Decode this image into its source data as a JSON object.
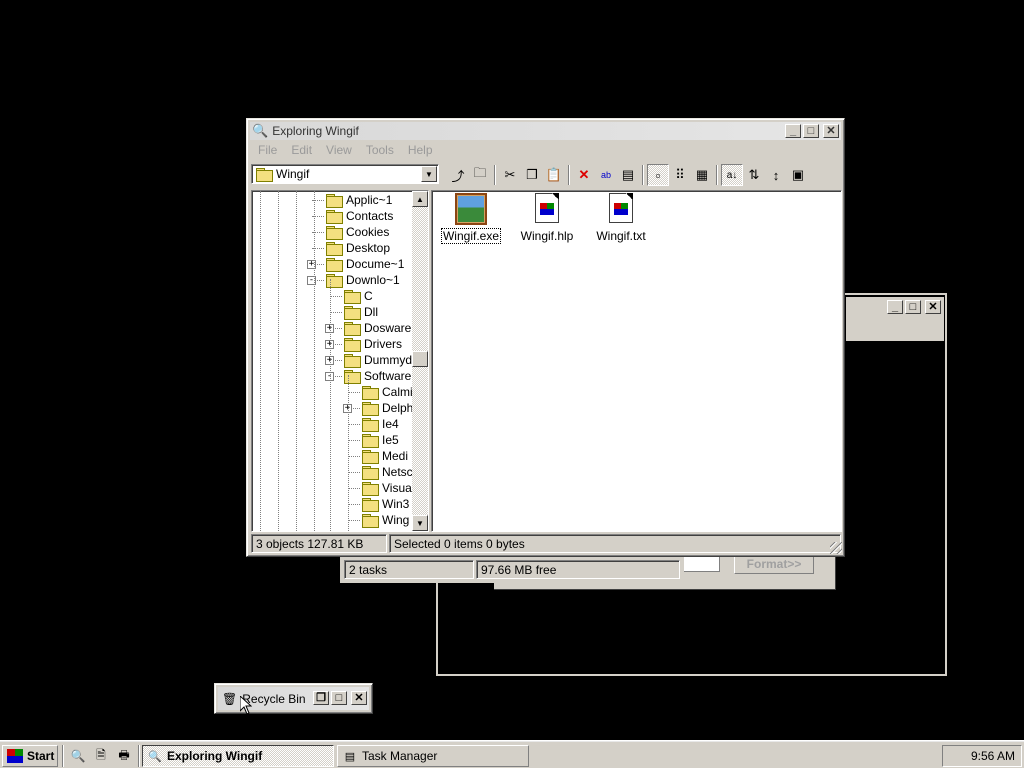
{
  "explorer": {
    "title": "Exploring Wingif",
    "menu": [
      "File",
      "Edit",
      "View",
      "Tools",
      "Help"
    ],
    "address_value": "Wingif",
    "tree": [
      {
        "label": "Applic~1",
        "level": 3,
        "expander": ""
      },
      {
        "label": "Contacts",
        "level": 3,
        "expander": ""
      },
      {
        "label": "Cookies",
        "level": 3,
        "expander": ""
      },
      {
        "label": "Desktop",
        "level": 3,
        "expander": ""
      },
      {
        "label": "Docume~1",
        "level": 3,
        "expander": "+"
      },
      {
        "label": "Downlo~1",
        "level": 3,
        "expander": "-"
      },
      {
        "label": "C",
        "level": 4,
        "expander": ""
      },
      {
        "label": "Dll",
        "level": 4,
        "expander": ""
      },
      {
        "label": "Dosware",
        "level": 4,
        "expander": "+"
      },
      {
        "label": "Drivers",
        "level": 4,
        "expander": "+"
      },
      {
        "label": "Dummydl",
        "level": 4,
        "expander": "+"
      },
      {
        "label": "Software",
        "level": 4,
        "expander": "-"
      },
      {
        "label": "Calmi",
        "level": 5,
        "expander": ""
      },
      {
        "label": "Delph",
        "level": 5,
        "expander": "+"
      },
      {
        "label": "Ie4",
        "level": 5,
        "expander": ""
      },
      {
        "label": "Ie5",
        "level": 5,
        "expander": ""
      },
      {
        "label": "Medi",
        "level": 5,
        "expander": ""
      },
      {
        "label": "Netsc",
        "level": 5,
        "expander": ""
      },
      {
        "label": "Visua",
        "level": 5,
        "expander": ""
      },
      {
        "label": "Win3",
        "level": 5,
        "expander": ""
      },
      {
        "label": "Wing",
        "level": 5,
        "expander": ""
      }
    ],
    "files": [
      {
        "name": "Wingif.exe",
        "type": "exe",
        "selected": true
      },
      {
        "name": "Wingif.hlp",
        "type": "hlp"
      },
      {
        "name": "Wingif.txt",
        "type": "txt"
      }
    ],
    "status_objects": "3 objects  127.81 KB",
    "status_selected": "Selected 0 items  0 bytes"
  },
  "task_manager_window": {
    "status_tasks": "2 tasks",
    "status_free": "97.66 MB free"
  },
  "format_button": "Format>>",
  "recycle_bin": {
    "title": "Recycle Bin"
  },
  "taskbar": {
    "start_label": "Start",
    "tasks": [
      "Exploring Wingif",
      "Task Manager"
    ],
    "clock": "9:56 AM"
  }
}
